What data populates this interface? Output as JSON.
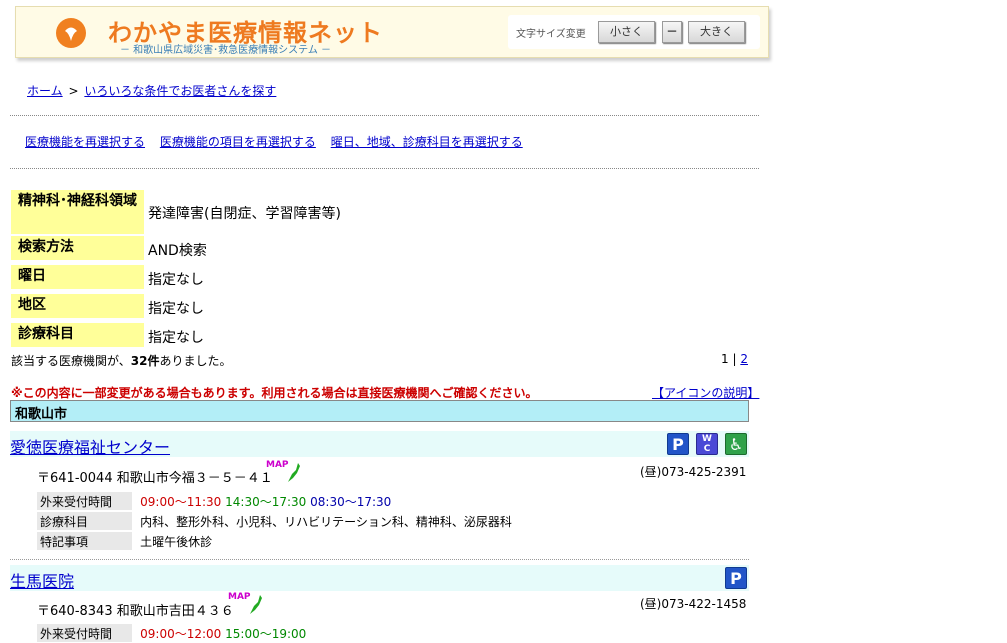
{
  "header": {
    "title": "わかやま医療情報ネット",
    "subtitle": "－ 和歌山県広域災害･救急医療情報システム －",
    "font_size_label": "文字サイズ変更",
    "smaller_label": "小さく",
    "reset_label": "－",
    "larger_label": "大きく",
    "brand_color": "#ee7a20"
  },
  "breadcrumb": {
    "home": "ホーム",
    "separator": ">",
    "current": "いろいろな条件でお医者さんを探す"
  },
  "reselect_links": [
    "医療機能を再選択する",
    "医療機能の項目を再選択する",
    "曜日、地域、診療科目を再選択する"
  ],
  "criteria": [
    {
      "key": "精神科･神経科領域",
      "value": "発達障害(自閉症、学習障害等)"
    },
    {
      "key": "検索方法",
      "value": "AND検索"
    },
    {
      "key": "曜日",
      "value": "指定なし"
    },
    {
      "key": "地区",
      "value": "指定なし"
    },
    {
      "key": "診療科目",
      "value": "指定なし"
    }
  ],
  "result": {
    "prefix": "該当する医療機関が、",
    "count": "32件",
    "suffix": "ありました。",
    "page_current": "1",
    "page_sep": "|",
    "page_next": "2"
  },
  "notice": "※この内容に一部変更がある場合もあります。利用される場合は直接医療機関へご確認ください。",
  "icon_help": "【アイコンの説明】",
  "city": "和歌山市",
  "facilities": [
    {
      "name": "愛徳医療福祉センター",
      "icons": [
        "parking-icon",
        "wheelchair-toilet-icon",
        "wheelchair-icon"
      ],
      "address": "〒641-0044 和歌山市今福３－５－４１",
      "map_label": "MAP",
      "phone": "(昼)073-425-2391",
      "hours_label": "外来受付時間",
      "hours": [
        "09:00～11:30",
        "14:30～17:30",
        "08:30～17:30"
      ],
      "dept_label": "診療科目",
      "depts": "内科、整形外科、小児科、リハビリテーション科、精神科、泌尿器科",
      "note_label": "特記事項",
      "note": "土曜午後休診"
    },
    {
      "name": "生馬医院",
      "icons": [
        "parking-icon"
      ],
      "address": "〒640-8343 和歌山市吉田４３６",
      "map_label": "MAP",
      "phone": "(昼)073-422-1458",
      "hours_label": "外来受付時間",
      "hours": [
        "09:00～12:00",
        "15:00～19:00"
      ]
    }
  ]
}
